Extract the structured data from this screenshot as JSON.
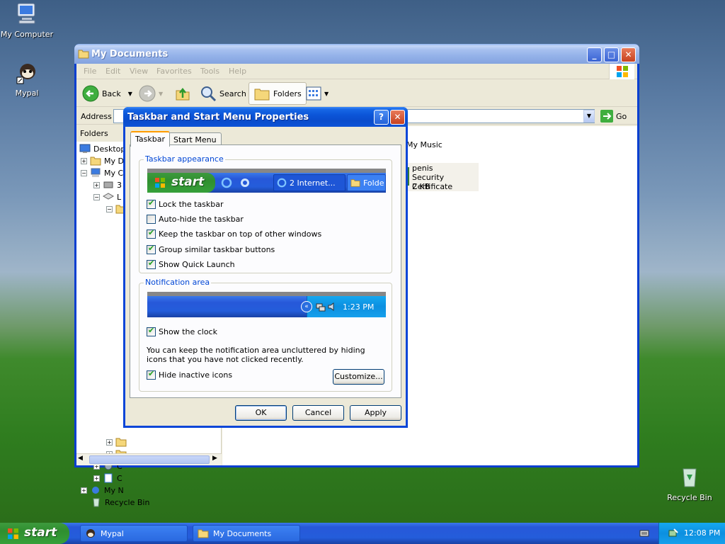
{
  "desktop": {
    "icons": [
      {
        "label": "My Computer"
      },
      {
        "label": "Mypal"
      },
      {
        "label": "Recycle Bin"
      }
    ]
  },
  "explorer": {
    "title": "My Documents",
    "menu": [
      "File",
      "Edit",
      "View",
      "Favorites",
      "Tools",
      "Help"
    ],
    "toolbar": {
      "back": "Back",
      "search": "Search",
      "folders": "Folders"
    },
    "address_label": "Address",
    "go_label": "Go",
    "folders_header": "Folders",
    "tree": [
      {
        "label": "Desktop"
      },
      {
        "label": "My D"
      },
      {
        "label": "My C"
      },
      {
        "label": "3"
      },
      {
        "label": "L"
      },
      {
        "label": "C"
      },
      {
        "label": "C"
      },
      {
        "label": "My N"
      },
      {
        "label": "Recycle Bin"
      }
    ],
    "files": [
      {
        "name": "My Music"
      },
      {
        "name": "penis",
        "type": "Security Certificate",
        "size": "2 KB"
      }
    ]
  },
  "dialog": {
    "title": "Taskbar and Start Menu Properties",
    "tabs": [
      "Taskbar",
      "Start Menu"
    ],
    "taskbar_group": {
      "legend": "Taskbar appearance",
      "preview": {
        "start": "start",
        "btn1": "2 Internet...",
        "btn2": "Folde"
      },
      "options": [
        {
          "label": "Lock the taskbar",
          "checked": true
        },
        {
          "label": "Auto-hide the taskbar",
          "checked": false
        },
        {
          "label": "Keep the taskbar on top of other windows",
          "checked": true
        },
        {
          "label": "Group similar taskbar buttons",
          "checked": true
        },
        {
          "label": "Show Quick Launch",
          "checked": true
        }
      ]
    },
    "notif_group": {
      "legend": "Notification area",
      "preview_time": "1:23 PM",
      "show_clock": "Show the clock",
      "description": "You can keep the notification area uncluttered by hiding icons that you have not clicked recently.",
      "hide_inactive": "Hide inactive icons",
      "customize": "Customize..."
    },
    "buttons": {
      "ok": "OK",
      "cancel": "Cancel",
      "apply": "Apply"
    }
  },
  "taskbar": {
    "start": "start",
    "tasks": [
      {
        "label": "Mypal"
      },
      {
        "label": "My Documents"
      }
    ],
    "clock": "12:08 PM"
  }
}
